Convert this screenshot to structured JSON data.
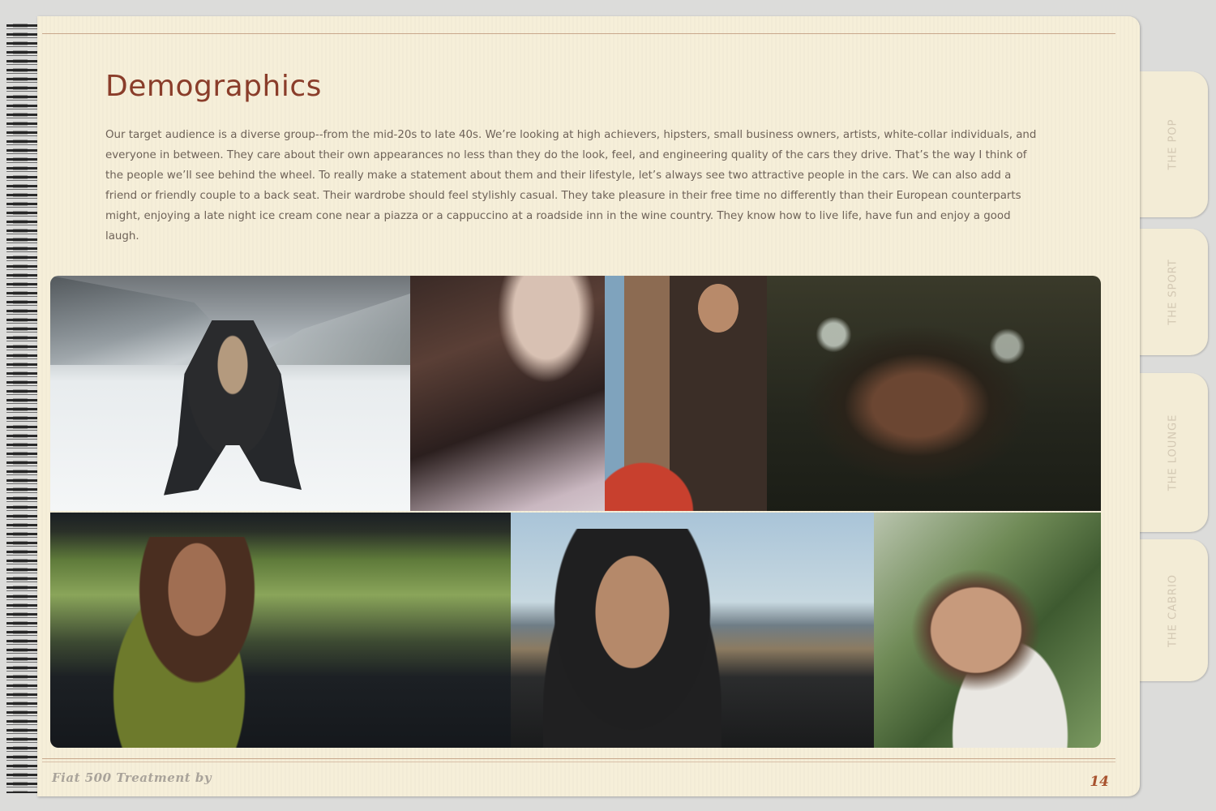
{
  "page": {
    "title": "Demographics",
    "body": "Our target audience is a diverse group--from the mid-20s to late 40s. We’re looking at high achievers, hipsters, small business owners, artists, white-collar individuals, and everyone in between. They care about their own appearances no less than they do the look, feel, and engineering quality of the cars they drive.  That’s the way I think of the people we’ll see behind the wheel.  To really make a statement about them and their lifestyle, let’s always see two attractive people in the cars. We can also add a friend or friendly couple to a back seat.  Their wardrobe should feel stylishly casual.  They take pleasure in their free time no differently than their European counterparts might, enjoying a late night ice cream cone near a piazza or a cappuccino at a roadside inn in the wine country. They know how to live life, have fun and enjoy a good laugh."
  },
  "tabs": [
    {
      "label": "THE POP"
    },
    {
      "label": "THE SPORT"
    },
    {
      "label": "THE LOUNGE"
    },
    {
      "label": "THE CABRIO"
    }
  ],
  "footer": {
    "brand": "Fiat 500 Treatment by",
    "page_number": "14"
  },
  "colors": {
    "title": "#8a3d2a",
    "body_text": "#6e6258",
    "paper": "#f6efd9",
    "tab_text": "#d3c8b3",
    "page_number": "#a8522e"
  }
}
